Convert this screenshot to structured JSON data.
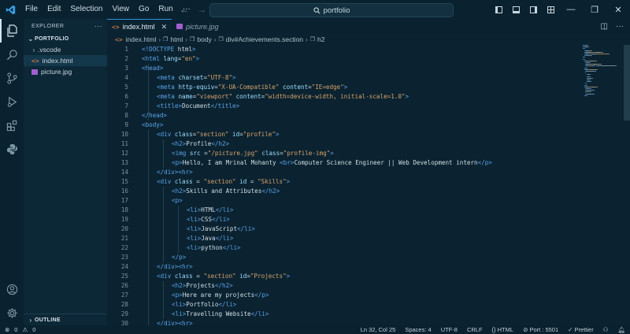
{
  "menu": [
    "File",
    "Edit",
    "Selection",
    "View",
    "Go",
    "Run",
    "···"
  ],
  "search": {
    "text": "portfolio"
  },
  "sidebar": {
    "header": "EXPLORER",
    "folder": "PORTFOLIO",
    "items": [
      ".vscode",
      "index.html",
      "picture.jpg"
    ],
    "outline": "OUTLINE"
  },
  "tabs": [
    {
      "label": "index.html"
    },
    {
      "label": "picture.jpg"
    }
  ],
  "breadcrumb": [
    "index.html",
    "html",
    "body",
    "div#Achievements.section",
    "h2"
  ],
  "code": {
    "current_line": 32,
    "lines": [
      [
        [
          "t",
          "<!"
        ],
        [
          "d",
          "DOCTYPE"
        ],
        [
          "x",
          " html"
        ],
        [
          "t",
          ">"
        ]
      ],
      [
        [
          "t",
          "<html"
        ],
        [
          "x",
          " "
        ],
        [
          "a",
          "lang"
        ],
        [
          "x",
          "="
        ],
        [
          "s",
          "\"en\""
        ],
        [
          "t",
          ">"
        ]
      ],
      [
        [
          "t",
          "<head>"
        ]
      ],
      [
        [
          "t",
          "<meta"
        ],
        [
          "x",
          " "
        ],
        [
          "a",
          "charset"
        ],
        [
          "x",
          "="
        ],
        [
          "s",
          "\"UTF-8\""
        ],
        [
          "t",
          ">"
        ]
      ],
      [
        [
          "t",
          "<meta"
        ],
        [
          "x",
          " "
        ],
        [
          "a",
          "http-equiv"
        ],
        [
          "x",
          "="
        ],
        [
          "s",
          "\"X-UA-Compatible\""
        ],
        [
          "x",
          " "
        ],
        [
          "a",
          "content"
        ],
        [
          "x",
          "="
        ],
        [
          "s",
          "\"IE=edge\""
        ],
        [
          "t",
          ">"
        ]
      ],
      [
        [
          "t",
          "<meta"
        ],
        [
          "x",
          " "
        ],
        [
          "a",
          "name"
        ],
        [
          "x",
          "="
        ],
        [
          "s",
          "\"viewport\""
        ],
        [
          "x",
          " "
        ],
        [
          "a",
          "content"
        ],
        [
          "x",
          "="
        ],
        [
          "s",
          "\"width=device-width, initial-scale=1.0\""
        ],
        [
          "t",
          ">"
        ]
      ],
      [
        [
          "t",
          "<title>"
        ],
        [
          "x",
          "Document"
        ],
        [
          "t",
          "</title>"
        ]
      ],
      [
        [
          "t",
          "</head>"
        ]
      ],
      [
        [
          "t",
          "<body>"
        ]
      ],
      [
        [
          "t",
          "<div"
        ],
        [
          "x",
          " "
        ],
        [
          "a",
          "class"
        ],
        [
          "x",
          "="
        ],
        [
          "s",
          "\"section\""
        ],
        [
          "x",
          " "
        ],
        [
          "a",
          "id"
        ],
        [
          "x",
          "="
        ],
        [
          "s",
          "\"profile\""
        ],
        [
          "t",
          ">"
        ]
      ],
      [
        [
          "t",
          "<h2>"
        ],
        [
          "x",
          "Profile"
        ],
        [
          "t",
          "</h2>"
        ]
      ],
      [
        [
          "t",
          "<img"
        ],
        [
          "x",
          " "
        ],
        [
          "a",
          "src"
        ],
        [
          "x",
          " ="
        ],
        [
          "s",
          "\"/picture.jpg\""
        ],
        [
          "x",
          " "
        ],
        [
          "a",
          "class"
        ],
        [
          "x",
          "="
        ],
        [
          "s",
          "\"profile-img\""
        ],
        [
          "t",
          ">"
        ]
      ],
      [
        [
          "t",
          "<p>"
        ],
        [
          "x",
          "Hello, I am Mrinal Mohanty "
        ],
        [
          "t",
          "<br>"
        ],
        [
          "x",
          "Computer Science Engineer || Web Development intern"
        ],
        [
          "t",
          "</p>"
        ]
      ],
      [
        [
          "t",
          "</div><hr>"
        ]
      ],
      [
        [
          "t",
          "<div"
        ],
        [
          "x",
          " "
        ],
        [
          "a",
          "class"
        ],
        [
          "x",
          " = "
        ],
        [
          "s",
          "\"section\""
        ],
        [
          "x",
          " "
        ],
        [
          "a",
          "id"
        ],
        [
          "x",
          " = "
        ],
        [
          "s",
          "\"Skills\""
        ],
        [
          "t",
          ">"
        ]
      ],
      [
        [
          "t",
          "<h2>"
        ],
        [
          "x",
          "Skills and Attributes"
        ],
        [
          "t",
          "</h2>"
        ]
      ],
      [
        [
          "t",
          "<p>"
        ]
      ],
      [
        [
          "t",
          "<li>"
        ],
        [
          "x",
          "HTML"
        ],
        [
          "t",
          "</li>"
        ]
      ],
      [
        [
          "t",
          "<li>"
        ],
        [
          "x",
          "CSS"
        ],
        [
          "t",
          "</li>"
        ]
      ],
      [
        [
          "t",
          "<li>"
        ],
        [
          "x",
          "JavaScript"
        ],
        [
          "t",
          "</li>"
        ]
      ],
      [
        [
          "t",
          "<li>"
        ],
        [
          "x",
          "Java"
        ],
        [
          "t",
          "</li>"
        ]
      ],
      [
        [
          "t",
          "<li>"
        ],
        [
          "x",
          "python"
        ],
        [
          "t",
          "</li>"
        ]
      ],
      [
        [
          "t",
          "</p>"
        ]
      ],
      [
        [
          "t",
          "</div><hr>"
        ]
      ],
      [
        [
          "t",
          "<div"
        ],
        [
          "x",
          " "
        ],
        [
          "a",
          "class"
        ],
        [
          "x",
          " = "
        ],
        [
          "s",
          "\"section\""
        ],
        [
          "x",
          " "
        ],
        [
          "a",
          "id"
        ],
        [
          "x",
          "="
        ],
        [
          "s",
          "\"Projects\""
        ],
        [
          "t",
          ">"
        ]
      ],
      [
        [
          "t",
          "<h2>"
        ],
        [
          "x",
          "Projects"
        ],
        [
          "t",
          "</h2>"
        ]
      ],
      [
        [
          "t",
          "<p>"
        ],
        [
          "x",
          "Here are my projects"
        ],
        [
          "t",
          "</p>"
        ]
      ],
      [
        [
          "t",
          "<li>"
        ],
        [
          "x",
          "Portfolio"
        ],
        [
          "t",
          "</li>"
        ]
      ],
      [
        [
          "t",
          "<li>"
        ],
        [
          "x",
          "Travelling Website"
        ],
        [
          "t",
          "</li>"
        ]
      ],
      [
        [
          "t",
          "</div><hr>"
        ]
      ]
    ]
  },
  "status": {
    "errors": "0",
    "warnings": "0",
    "position": "Ln 32, Col 25",
    "spaces": "Spaces: 4",
    "encoding": "UTF-8",
    "eol": "CRLF",
    "language": "HTML",
    "port": "Port : 5501",
    "prettier": "Prettier"
  },
  "colors": {
    "accent": "#2f8fd6",
    "background": "#0b2331",
    "sidebar": "#0c2736",
    "tag": "#5aa3e8",
    "attr": "#9cdcfe",
    "string": "#d7a26a"
  }
}
